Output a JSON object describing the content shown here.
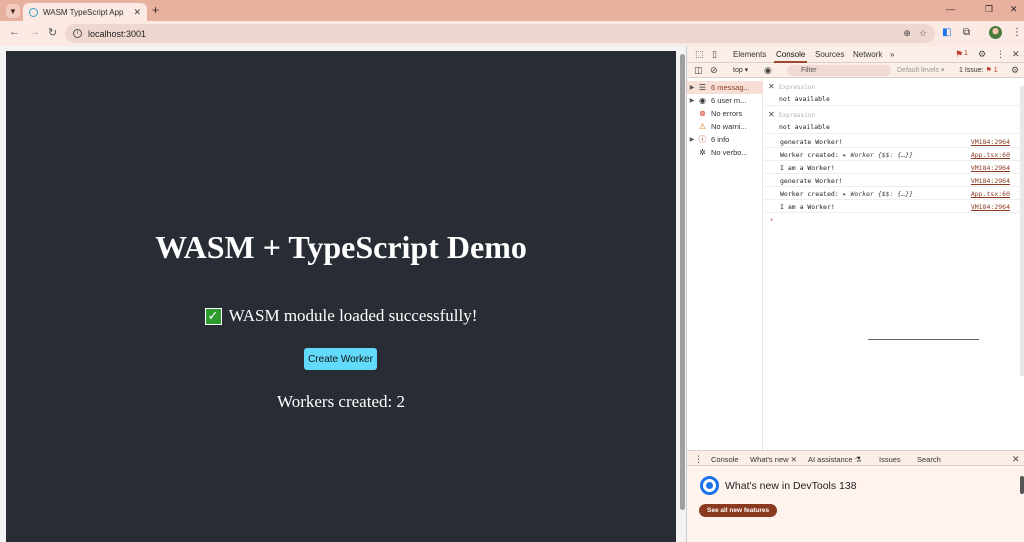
{
  "browser": {
    "tab_title": "WASM TypeScript App",
    "new_tab_symbol": "+",
    "url": "localhost:3001"
  },
  "app": {
    "title": "WASM + TypeScript Demo",
    "status_text": "WASM module loaded successfully!",
    "status_icon": "✓",
    "button_label": "Create Worker",
    "workers_text": "Workers created: 2"
  },
  "devtools": {
    "tabs": [
      "Elements",
      "Console",
      "Sources",
      "Network"
    ],
    "more_tabs": "»",
    "issues_badge": "1",
    "context": "top ▾",
    "filter_placeholder": "Filter",
    "levels": "Default levels ▾",
    "issue_count": "1 Issue:",
    "issue_count_num": "1",
    "sidebar": [
      {
        "label": "6 messag...",
        "icon": "list-icon",
        "caret": "▶"
      },
      {
        "label": "6 user m...",
        "icon": "user-icon",
        "caret": "▶"
      },
      {
        "label": "No errors",
        "icon": "error-icon",
        "caret": ""
      },
      {
        "label": "No warni...",
        "icon": "warning-icon",
        "caret": ""
      },
      {
        "label": "6 info",
        "icon": "info-icon",
        "caret": "▶"
      },
      {
        "label": "No verbo...",
        "icon": "verbose-icon",
        "caret": ""
      }
    ],
    "expressions": [
      {
        "label": "Expression",
        "value": "not available"
      },
      {
        "label": "Expression",
        "value": "not available"
      }
    ],
    "logs": [
      {
        "msg": "generate Worker!",
        "obj": "",
        "src": "VM184:2964"
      },
      {
        "msg": "Worker created: ",
        "obj": "▸ Worker {$$: {…}}",
        "src": "App.tsx:60"
      },
      {
        "msg": "I am a Worker!",
        "obj": "",
        "src": "VM184:2964"
      },
      {
        "msg": "generate Worker!",
        "obj": "",
        "src": "VM184:2964"
      },
      {
        "msg": "Worker created: ",
        "obj": "▸ Worker {$$: {…}}",
        "src": "App.tsx:60"
      },
      {
        "msg": "I am a Worker!",
        "obj": "",
        "src": "VM184:2964"
      }
    ],
    "prompt": "›",
    "drawer_tabs": [
      "Console",
      "What's new ✕",
      "AI assistance ⚗",
      "Issues",
      "Search"
    ],
    "whats_new_title": "What's new in DevTools 138",
    "see_all_label": "See all new features"
  },
  "colors": {
    "app_bg": "#282c34",
    "button_bg": "#61dafb",
    "tabstrip": "#e8b09f",
    "accent": "#8b3a1f"
  }
}
